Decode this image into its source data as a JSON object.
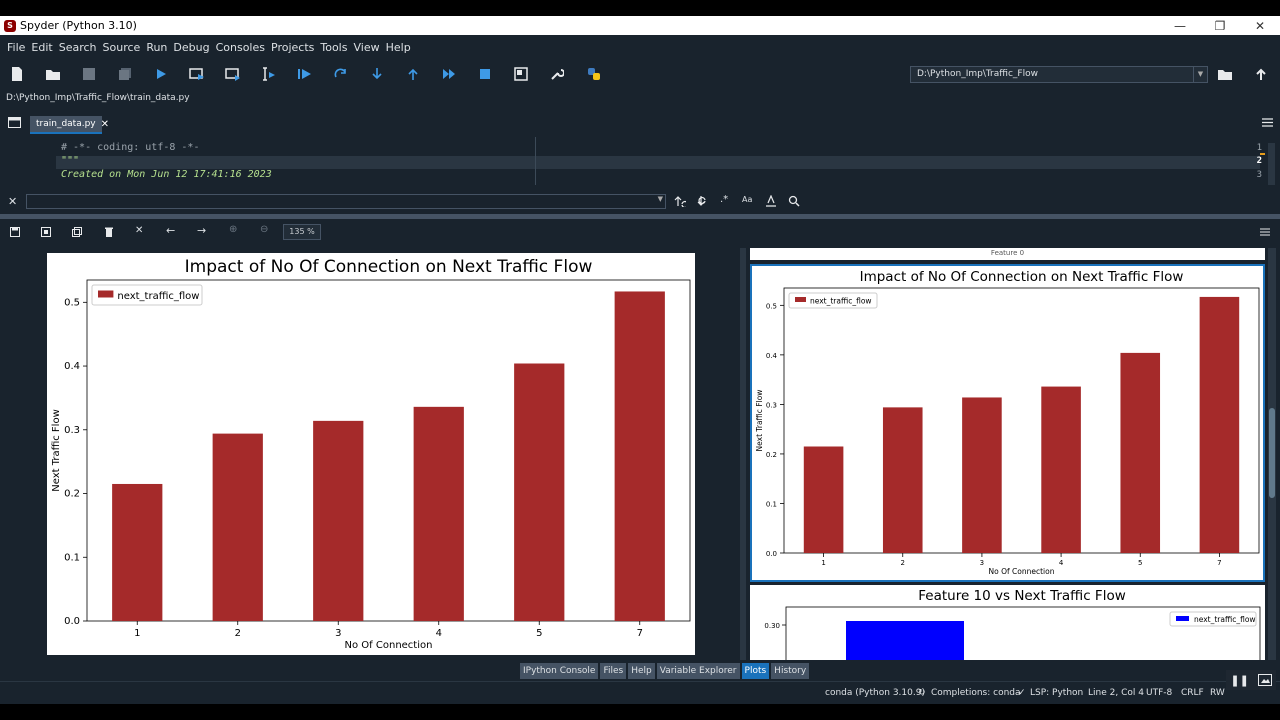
{
  "window": {
    "title": "Spyder (Python 3.10)",
    "logo": "spyder-logo"
  },
  "menu": [
    "File",
    "Edit",
    "Search",
    "Source",
    "Run",
    "Debug",
    "Consoles",
    "Projects",
    "Tools",
    "View",
    "Help"
  ],
  "toolbar": {
    "working_dir": "D:\\Python_Imp\\Traffic_Flow"
  },
  "editor": {
    "file_path": "D:\\Python_Imp\\Traffic_Flow\\train_data.py",
    "tab_label": "train_data.py",
    "lines": [
      {
        "num": "1",
        "text": "# -*- coding: utf-8 -*-"
      },
      {
        "num": "2",
        "text": "\"\"\""
      },
      {
        "num": "3",
        "text": "Created on Mon Jun 12 17:41:16 2023"
      }
    ]
  },
  "plots": {
    "zoom": "135 %",
    "thumb_top_label": "Feature 0"
  },
  "chart_data": [
    {
      "type": "bar",
      "title": "Impact of No Of Connection on Next Traffic Flow",
      "xlabel": "No Of Connection",
      "ylabel": "Next Traffic Flow",
      "categories": [
        "1",
        "2",
        "3",
        "4",
        "5",
        "7"
      ],
      "series": [
        {
          "name": "next_traffic_flow",
          "values": [
            0.215,
            0.294,
            0.314,
            0.336,
            0.404,
            0.517
          ],
          "color": "#a52a2a"
        }
      ],
      "yticks": [
        "0.0",
        "0.1",
        "0.2",
        "0.3",
        "0.4",
        "0.5"
      ],
      "ylim": [
        0,
        0.535
      ],
      "legend": "top-left"
    },
    {
      "type": "bar",
      "title": "Feature 10 vs Next Traffic Flow",
      "categories": [],
      "series": [
        {
          "name": "next_traffic_flow",
          "values": [
            0.31
          ],
          "color": "#0000ff"
        }
      ],
      "yticks": [
        "0.30"
      ],
      "legend": "top-right"
    }
  ],
  "bottom_tabs": [
    "IPython Console",
    "Files",
    "Help",
    "Variable Explorer",
    "Plots",
    "History"
  ],
  "active_bottom_tab": "Plots",
  "status": {
    "env": "conda (Python 3.10.9)",
    "completions": "Completions: conda",
    "lsp": "LSP: Python",
    "position": "Line 2, Col 4",
    "encoding": "UTF-8",
    "eol": "CRLF",
    "rw": "RW"
  },
  "colors": {
    "bg": "#19232d",
    "accent": "#1a72bb",
    "bar": "#a52a2a"
  }
}
